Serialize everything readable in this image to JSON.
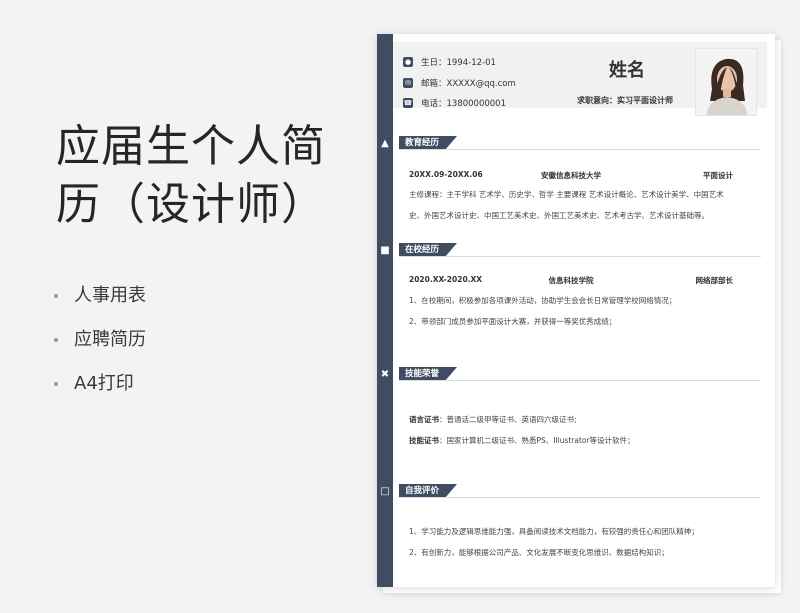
{
  "promo": {
    "title": "应届生个人简历（设计师）",
    "items": [
      "人事用表",
      "应聘简历",
      "A4打印"
    ]
  },
  "resume": {
    "birthday": "生日：1994-12-01",
    "email": "邮箱：XXXXX@qq.com",
    "phone": "电话：13800000001",
    "name": "姓名",
    "objective": "求职意向：实习平面设计师",
    "sections": {
      "education": {
        "title": "教育经历",
        "period": "20XX.09-20XX.06",
        "school": "安徽信息科技大学",
        "major": "平面设计",
        "courses_label": "主修课程：",
        "courses_line1": "主干学科 艺术学、历史学、哲学 主要课程 艺术设计概论、艺术设计美学、中国艺术",
        "courses_line2": "史、外国艺术设计史、中国工艺美术史、外国工艺美术史、艺术考古学、艺术设计基础等。"
      },
      "campus": {
        "title": "在校经历",
        "period": "2020.XX-2020.XX",
        "org": "信息科技学院",
        "role": "网络部部长",
        "items": [
          "1、在校期间，积极参加各项课外活动，协助学生会会长日常管理学校网络情况；",
          "2、带领部门成员参加平面设计大赛，并获得一等奖优秀成绩；"
        ]
      },
      "skills": {
        "title": "技能荣誉",
        "lang_label": "语言证书",
        "lang_value": "：普通话二级甲等证书、英语四六级证书;",
        "tech_label": "技能证书",
        "tech_value": "：国家计算机二级证书、熟悉PS、Illustrator等设计软件；"
      },
      "self": {
        "title": "自我评价",
        "items": [
          "1、学习能力及逻辑思维能力强，具备阅读技术文档能力，有较强的责任心和团队精神；",
          "2、有创新力，能够根据公司产品、文化发展不断变化思维识、数据结构知识；"
        ]
      }
    }
  },
  "colors": {
    "accent": "#3f4c61",
    "header_bg": "#f1f1f2"
  },
  "icons": [
    "user-icon",
    "mail-icon",
    "phone-icon",
    "graduation-cap-icon",
    "briefcase-icon",
    "tools-icon",
    "comment-icon"
  ]
}
